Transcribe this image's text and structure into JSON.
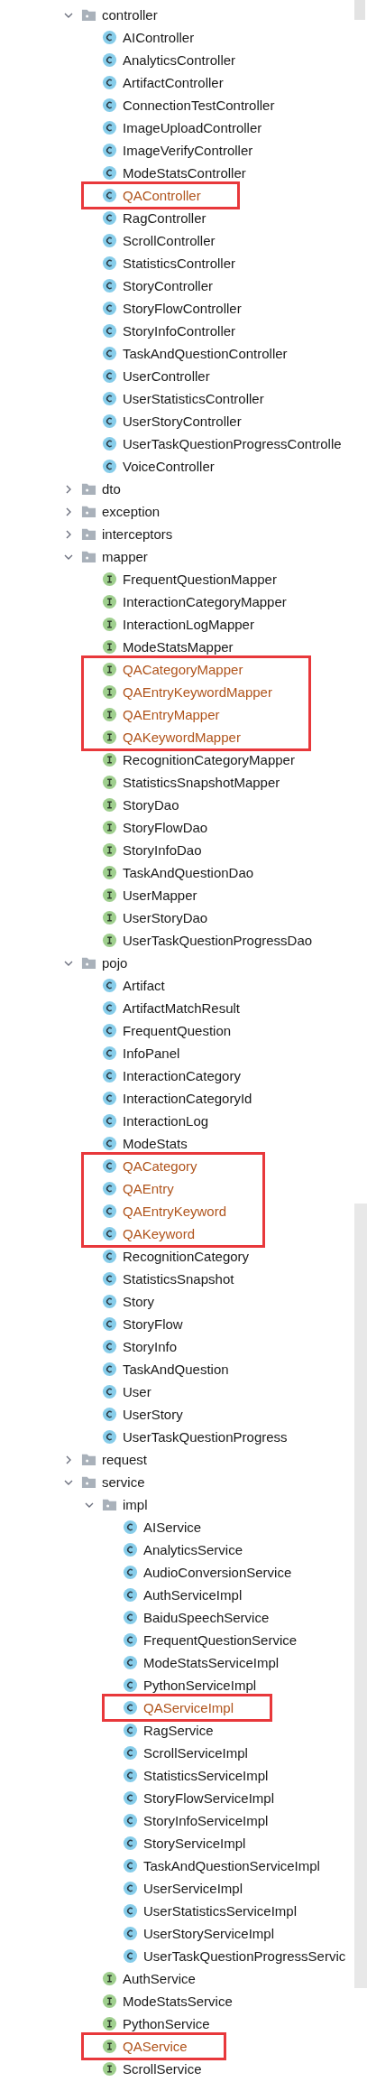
{
  "tree": [
    {
      "kind": "folder",
      "name": "controller",
      "expanded": true,
      "children": [
        {
          "kind": "class",
          "name": "AIController"
        },
        {
          "kind": "class",
          "name": "AnalyticsController"
        },
        {
          "kind": "class",
          "name": "ArtifactController"
        },
        {
          "kind": "class",
          "name": "ConnectionTestController"
        },
        {
          "kind": "class",
          "name": "ImageUploadController"
        },
        {
          "kind": "class",
          "name": "ImageVerifyController"
        },
        {
          "kind": "class",
          "name": "ModeStatsController"
        },
        {
          "kind": "class",
          "name": "QAController",
          "added": true,
          "highlighted": true
        },
        {
          "kind": "class",
          "name": "RagController"
        },
        {
          "kind": "class",
          "name": "ScrollController"
        },
        {
          "kind": "class",
          "name": "StatisticsController"
        },
        {
          "kind": "class",
          "name": "StoryController"
        },
        {
          "kind": "class",
          "name": "StoryFlowController"
        },
        {
          "kind": "class",
          "name": "StoryInfoController"
        },
        {
          "kind": "class",
          "name": "TaskAndQuestionController"
        },
        {
          "kind": "class",
          "name": "UserController"
        },
        {
          "kind": "class",
          "name": "UserStatisticsController"
        },
        {
          "kind": "class",
          "name": "UserStoryController"
        },
        {
          "kind": "class",
          "name": "UserTaskQuestionProgressControlle"
        },
        {
          "kind": "class",
          "name": "VoiceController"
        }
      ]
    },
    {
      "kind": "folder",
      "name": "dto",
      "expanded": false
    },
    {
      "kind": "folder",
      "name": "exception",
      "expanded": false
    },
    {
      "kind": "folder",
      "name": "interceptors",
      "expanded": false
    },
    {
      "kind": "folder",
      "name": "mapper",
      "expanded": true,
      "children": [
        {
          "kind": "interface",
          "name": "FrequentQuestionMapper"
        },
        {
          "kind": "interface",
          "name": "InteractionCategoryMapper"
        },
        {
          "kind": "interface",
          "name": "InteractionLogMapper"
        },
        {
          "kind": "interface",
          "name": "ModeStatsMapper"
        },
        {
          "kind": "interface",
          "name": "QACategoryMapper",
          "added": true,
          "highlighted": true
        },
        {
          "kind": "interface",
          "name": "QAEntryKeywordMapper",
          "added": true,
          "highlighted": true
        },
        {
          "kind": "interface",
          "name": "QAEntryMapper",
          "added": true,
          "highlighted": true
        },
        {
          "kind": "interface",
          "name": "QAKeywordMapper",
          "added": true,
          "highlighted": true
        },
        {
          "kind": "interface",
          "name": "RecognitionCategoryMapper"
        },
        {
          "kind": "interface",
          "name": "StatisticsSnapshotMapper"
        },
        {
          "kind": "interface",
          "name": "StoryDao"
        },
        {
          "kind": "interface",
          "name": "StoryFlowDao"
        },
        {
          "kind": "interface",
          "name": "StoryInfoDao"
        },
        {
          "kind": "interface",
          "name": "TaskAndQuestionDao"
        },
        {
          "kind": "interface",
          "name": "UserMapper"
        },
        {
          "kind": "interface",
          "name": "UserStoryDao"
        },
        {
          "kind": "interface",
          "name": "UserTaskQuestionProgressDao"
        }
      ]
    },
    {
      "kind": "folder",
      "name": "pojo",
      "expanded": true,
      "children": [
        {
          "kind": "class",
          "name": "Artifact"
        },
        {
          "kind": "class",
          "name": "ArtifactMatchResult"
        },
        {
          "kind": "class",
          "name": "FrequentQuestion"
        },
        {
          "kind": "class",
          "name": "InfoPanel"
        },
        {
          "kind": "class",
          "name": "InteractionCategory"
        },
        {
          "kind": "class",
          "name": "InteractionCategoryId"
        },
        {
          "kind": "class",
          "name": "InteractionLog"
        },
        {
          "kind": "class",
          "name": "ModeStats"
        },
        {
          "kind": "class",
          "name": "QACategory",
          "added": true,
          "highlighted": true
        },
        {
          "kind": "class",
          "name": "QAEntry",
          "added": true,
          "highlighted": true
        },
        {
          "kind": "class",
          "name": "QAEntryKeyword",
          "added": true,
          "highlighted": true
        },
        {
          "kind": "class",
          "name": "QAKeyword",
          "added": true,
          "highlighted": true
        },
        {
          "kind": "class",
          "name": "RecognitionCategory"
        },
        {
          "kind": "class",
          "name": "StatisticsSnapshot"
        },
        {
          "kind": "class",
          "name": "Story"
        },
        {
          "kind": "class",
          "name": "StoryFlow"
        },
        {
          "kind": "class",
          "name": "StoryInfo"
        },
        {
          "kind": "class",
          "name": "TaskAndQuestion"
        },
        {
          "kind": "class",
          "name": "User"
        },
        {
          "kind": "class",
          "name": "UserStory"
        },
        {
          "kind": "class",
          "name": "UserTaskQuestionProgress"
        }
      ]
    },
    {
      "kind": "folder",
      "name": "request",
      "expanded": false
    },
    {
      "kind": "folder",
      "name": "service",
      "expanded": true,
      "children": [
        {
          "kind": "folder",
          "name": "impl",
          "expanded": true,
          "children": [
            {
              "kind": "class",
              "name": "AIService"
            },
            {
              "kind": "class",
              "name": "AnalyticsService"
            },
            {
              "kind": "class",
              "name": "AudioConversionService"
            },
            {
              "kind": "class",
              "name": "AuthServiceImpl"
            },
            {
              "kind": "class",
              "name": "BaiduSpeechService"
            },
            {
              "kind": "class",
              "name": "FrequentQuestionService"
            },
            {
              "kind": "class",
              "name": "ModeStatsServiceImpl"
            },
            {
              "kind": "class",
              "name": "PythonServiceImpl"
            },
            {
              "kind": "class",
              "name": "QAServiceImpl",
              "added": true,
              "highlighted": true
            },
            {
              "kind": "class",
              "name": "RagService"
            },
            {
              "kind": "class",
              "name": "ScrollServiceImpl"
            },
            {
              "kind": "class",
              "name": "StatisticsServiceImpl"
            },
            {
              "kind": "class",
              "name": "StoryFlowServiceImpl"
            },
            {
              "kind": "class",
              "name": "StoryInfoServiceImpl"
            },
            {
              "kind": "class",
              "name": "StoryServiceImpl"
            },
            {
              "kind": "class",
              "name": "TaskAndQuestionServiceImpl"
            },
            {
              "kind": "class",
              "name": "UserServiceImpl"
            },
            {
              "kind": "class",
              "name": "UserStatisticsServiceImpl"
            },
            {
              "kind": "class",
              "name": "UserStoryServiceImpl"
            },
            {
              "kind": "class",
              "name": "UserTaskQuestionProgressServic"
            }
          ]
        },
        {
          "kind": "interface",
          "name": "AuthService"
        },
        {
          "kind": "interface",
          "name": "ModeStatsService"
        },
        {
          "kind": "interface",
          "name": "PythonService"
        },
        {
          "kind": "interface",
          "name": "QAService",
          "added": true,
          "highlighted": true
        },
        {
          "kind": "interface",
          "name": "ScrollService"
        }
      ]
    }
  ]
}
